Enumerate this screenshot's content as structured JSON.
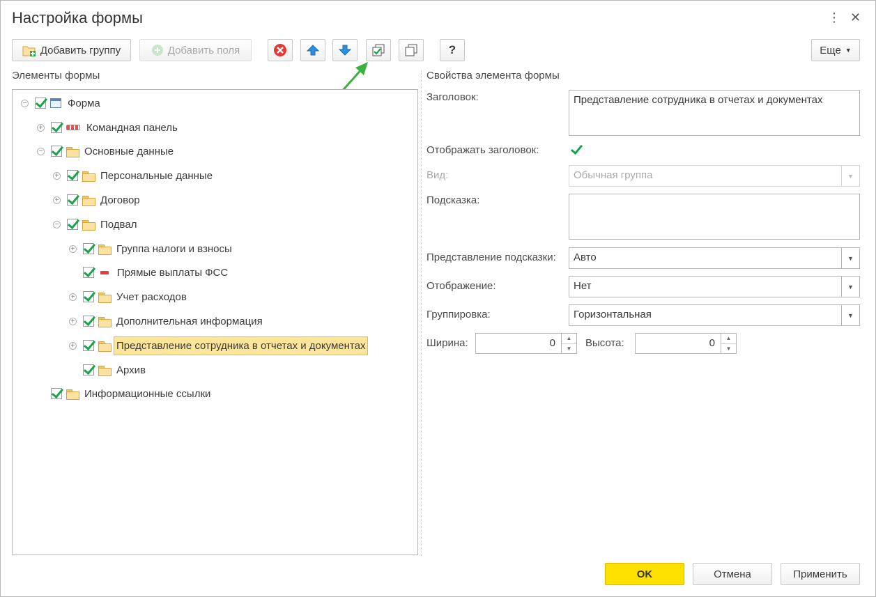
{
  "window": {
    "title": "Настройка формы"
  },
  "toolbar": {
    "add_group": "Добавить группу",
    "add_fields": "Добавить поля",
    "help": "?",
    "more": "Еще"
  },
  "left": {
    "section_title": "Элементы формы",
    "tree": [
      {
        "label": "Форма"
      },
      {
        "label": "Командная панель"
      },
      {
        "label": "Основные данные"
      },
      {
        "label": "Персональные данные"
      },
      {
        "label": "Договор"
      },
      {
        "label": "Подвал"
      },
      {
        "label": "Группа налоги и взносы"
      },
      {
        "label": "Прямые выплаты ФСС"
      },
      {
        "label": "Учет расходов"
      },
      {
        "label": "Дополнительная информация"
      },
      {
        "label": "Представление сотрудника в отчетах и документах",
        "selected": true
      },
      {
        "label": "Архив"
      },
      {
        "label": "Информационные ссылки"
      }
    ]
  },
  "right": {
    "section_title": "Свойства элемента формы",
    "title_label": "Заголовок:",
    "title_value": "Представление сотрудника в отчетах и документах",
    "show_title_label": "Отображать заголовок:",
    "show_title_checked": true,
    "view_label": "Вид:",
    "view_value": "Обычная группа",
    "hint_label": "Подсказка:",
    "hint_value": "",
    "hint_repr_label": "Представление подсказки:",
    "hint_repr_value": "Авто",
    "display_label": "Отображение:",
    "display_value": "Нет",
    "grouping_label": "Группировка:",
    "grouping_value": "Горизонтальная",
    "width_label": "Ширина:",
    "width_value": "0",
    "height_label": "Высота:",
    "height_value": "0"
  },
  "footer": {
    "ok": "OK",
    "cancel": "Отмена",
    "apply": "Применить"
  },
  "colors": {
    "ok_button": "#ffe100",
    "selection": "#fde69a",
    "annotation_arrow": "#3cb043"
  }
}
